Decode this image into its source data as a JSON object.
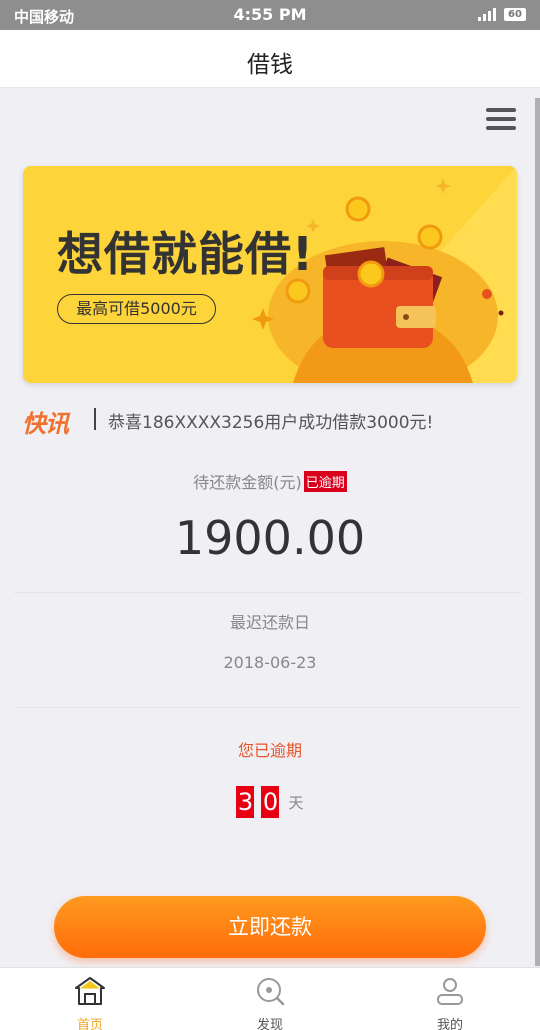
{
  "status_bar": {
    "carrier": "中国移动",
    "time": "4:55 PM",
    "battery": "60"
  },
  "nav": {
    "title": "借钱"
  },
  "banner": {
    "slogan": "想借就能借!",
    "max_amount": "最高可借5000元"
  },
  "ticker": {
    "brand": "快讯",
    "message": "恭喜186XXXX3256用户成功借款3000元!"
  },
  "repayment": {
    "amount_label": "待还款金额(元)",
    "overdue_badge": "已逾期",
    "amount": "1900.00",
    "due_date_label": "最迟还款日",
    "due_date": "2018-06-23",
    "overdue_label": "您已逾期",
    "overdue_days_digits": [
      "3",
      "0"
    ],
    "days_unit": "天"
  },
  "action": {
    "repay_button": "立即还款"
  },
  "tabs": [
    {
      "label": "首页",
      "icon": "home-icon",
      "active": true
    },
    {
      "label": "发现",
      "icon": "discover-icon",
      "active": false
    },
    {
      "label": "我的",
      "icon": "user-icon",
      "active": false
    }
  ],
  "colors": {
    "accent": "#f5a623",
    "button": "#ff7a10",
    "alert": "#e60012",
    "banner": "#fdd43a"
  }
}
